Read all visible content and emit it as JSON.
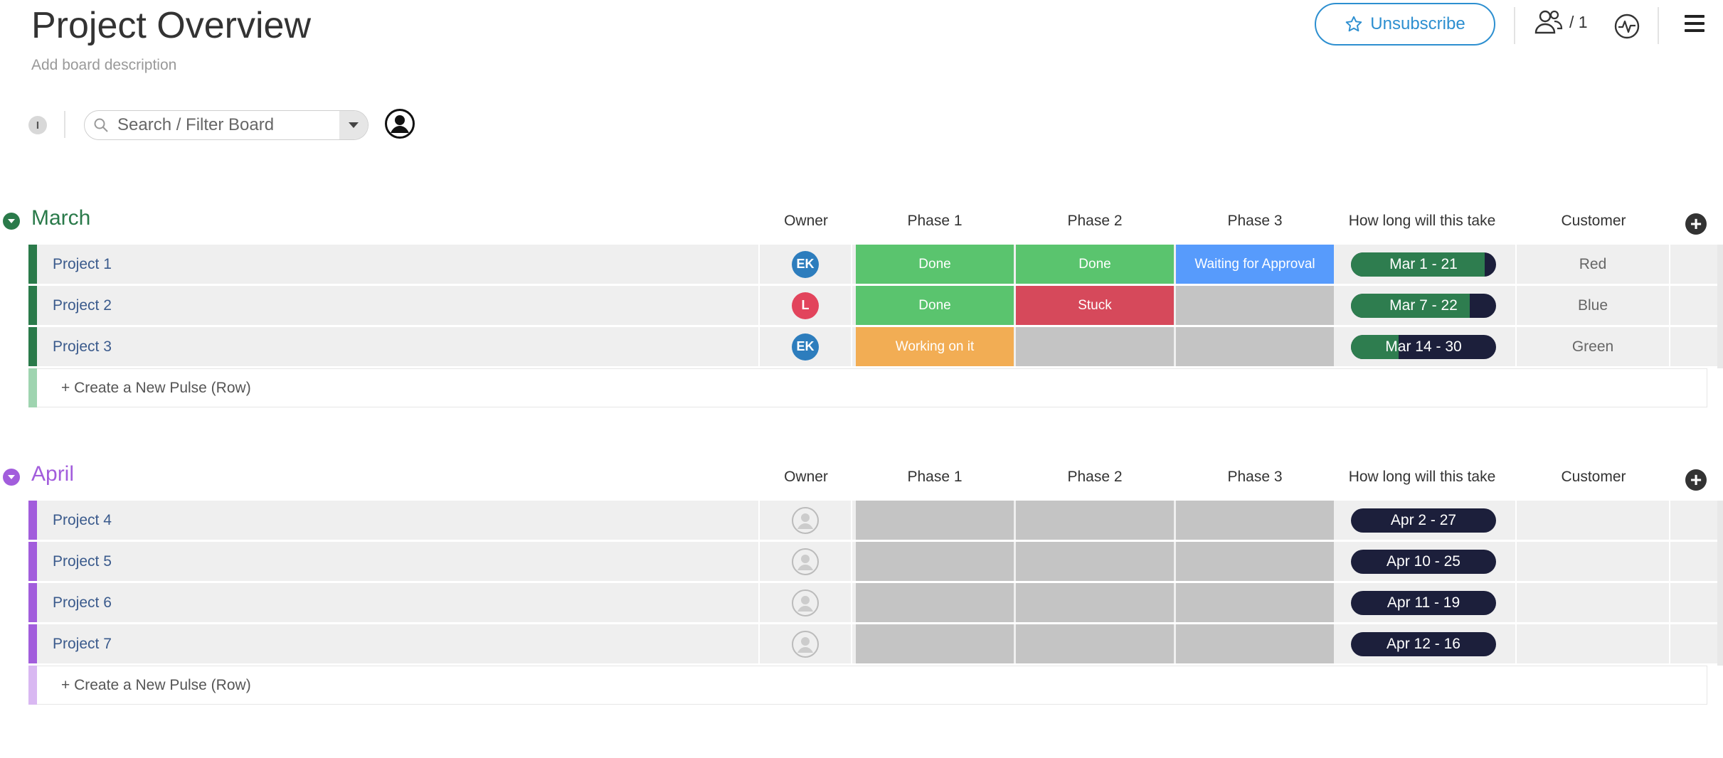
{
  "board": {
    "title": "Project Overview",
    "description": "Add board description"
  },
  "header": {
    "unsubscribe_label": "Unsubscribe",
    "members_count": "/ 1"
  },
  "search": {
    "placeholder": "Search / Filter Board"
  },
  "info_label": "I",
  "columns": [
    "Owner",
    "Phase 1",
    "Phase 2",
    "Phase 3",
    "How long will this take",
    "Customer"
  ],
  "colors": {
    "done": "#5ac46e",
    "stuck": "#d6495b",
    "waiting": "#579bfc",
    "working": "#f2ad54",
    "empty": "#c4c4c4",
    "march": "#2a7a4a",
    "april": "#a25ddc",
    "timeline_bg": "#1c1f3b",
    "timeline_fill": "#2e7d4f"
  },
  "groups": [
    {
      "title": "March",
      "color": "#2a7a4a",
      "light_color": "#9fd4b0",
      "new_row_label": "+ Create a New Pulse (Row)",
      "rows": [
        {
          "name": "Project 1",
          "owner": "EK",
          "owner_color": "#2d7dbd",
          "phases": [
            {
              "label": "Done",
              "state": "done"
            },
            {
              "label": "Done",
              "state": "done"
            },
            {
              "label": "Waiting for Approval",
              "state": "waiting"
            }
          ],
          "timeline": "Mar 1 - 21",
          "progress": 0.92,
          "customer": "Red"
        },
        {
          "name": "Project 2",
          "owner": "L",
          "owner_color": "#e2445c",
          "phases": [
            {
              "label": "Done",
              "state": "done"
            },
            {
              "label": "Stuck",
              "state": "stuck"
            },
            {
              "label": "",
              "state": "empty"
            }
          ],
          "timeline": "Mar 7 - 22",
          "progress": 0.82,
          "customer": "Blue"
        },
        {
          "name": "Project 3",
          "owner": "EK",
          "owner_color": "#2d7dbd",
          "phases": [
            {
              "label": "Working on it",
              "state": "working"
            },
            {
              "label": "",
              "state": "empty"
            },
            {
              "label": "",
              "state": "empty"
            }
          ],
          "timeline": "Mar 14 - 30",
          "progress": 0.33,
          "customer": "Green"
        }
      ]
    },
    {
      "title": "April",
      "color": "#a25ddc",
      "light_color": "#d9b8f2",
      "new_row_label": "+ Create a New Pulse (Row)",
      "rows": [
        {
          "name": "Project 4",
          "owner": "",
          "owner_color": "",
          "phases": [
            {
              "label": "",
              "state": "empty"
            },
            {
              "label": "",
              "state": "empty"
            },
            {
              "label": "",
              "state": "empty"
            }
          ],
          "timeline": "Apr 2 - 27",
          "progress": 0,
          "customer": ""
        },
        {
          "name": "Project 5",
          "owner": "",
          "owner_color": "",
          "phases": [
            {
              "label": "",
              "state": "empty"
            },
            {
              "label": "",
              "state": "empty"
            },
            {
              "label": "",
              "state": "empty"
            }
          ],
          "timeline": "Apr 10 - 25",
          "progress": 0,
          "customer": ""
        },
        {
          "name": "Project 6",
          "owner": "",
          "owner_color": "",
          "phases": [
            {
              "label": "",
              "state": "empty"
            },
            {
              "label": "",
              "state": "empty"
            },
            {
              "label": "",
              "state": "empty"
            }
          ],
          "timeline": "Apr 11 - 19",
          "progress": 0,
          "customer": ""
        },
        {
          "name": "Project 7",
          "owner": "",
          "owner_color": "",
          "phases": [
            {
              "label": "",
              "state": "empty"
            },
            {
              "label": "",
              "state": "empty"
            },
            {
              "label": "",
              "state": "empty"
            }
          ],
          "timeline": "Apr 12 - 16",
          "progress": 0,
          "customer": ""
        }
      ]
    }
  ]
}
